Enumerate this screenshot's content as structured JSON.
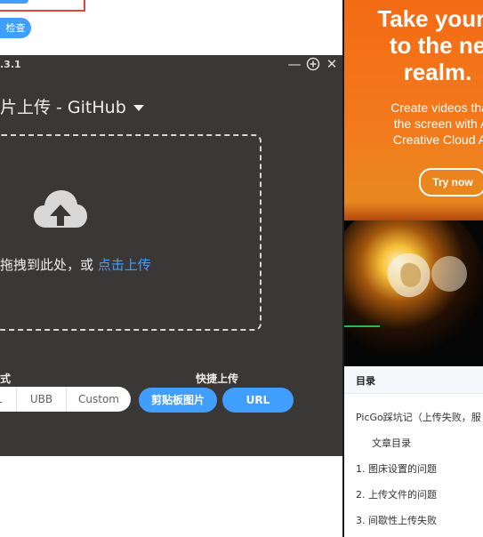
{
  "background": {
    "check_button_label": "检查"
  },
  "picgo": {
    "version": ".3.1",
    "heading": "片上传 - GitHub",
    "drop_text": "拖拽到此处，或",
    "drop_link": "点击上传",
    "format_label": "式",
    "quick_label": "快捷上传",
    "format_options": [
      "L",
      "UBB",
      "Custom"
    ],
    "clipboard_button": "剪贴板图片",
    "url_button": "URL"
  },
  "ad": {
    "headline": [
      "Take your i",
      "to the ne",
      "realm."
    ],
    "subline": [
      "Create videos that",
      "the screen with A",
      "Creative Cloud Al"
    ],
    "button": "Try now"
  },
  "toc": {
    "title": "目录",
    "items": [
      "PicGo踩坑记（上传失败，服",
      "文章目录",
      "1. 图床设置的问题",
      "2. 上传文件的问题",
      "3. 间歇性上传失败"
    ]
  },
  "colors": {
    "accent": "#409eff",
    "window_bg": "#3a3836",
    "ad_orange": "#f36b14"
  }
}
